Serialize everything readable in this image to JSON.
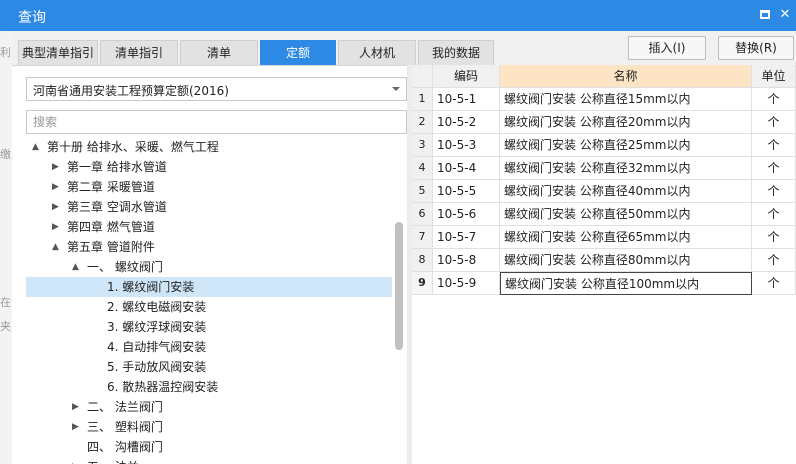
{
  "window": {
    "title": "查询",
    "maximize_icon": "maximize-icon",
    "close_icon": "close-icon",
    "close_glyph": "✕"
  },
  "left_edge_text": [
    "利",
    "缴",
    "在",
    "夹"
  ],
  "tabs": [
    {
      "label": "典型清单指引",
      "active": false
    },
    {
      "label": "清单指引",
      "active": false
    },
    {
      "label": "清单",
      "active": false
    },
    {
      "label": "定额",
      "active": true
    },
    {
      "label": "人材机",
      "active": false
    },
    {
      "label": "我的数据",
      "active": false
    }
  ],
  "toolbar": {
    "insert_label": "插入(I)",
    "replace_label": "替换(R)"
  },
  "left": {
    "library": "河南省通用安装工程预算定额(2016)",
    "search_placeholder": "搜索"
  },
  "tree": [
    {
      "label": "第十册 给排水、采暖、燃气工程",
      "level": 0,
      "expander": "▲",
      "selected": false
    },
    {
      "label": "第一章 给排水管道",
      "level": 1,
      "expander": "▶",
      "selected": false
    },
    {
      "label": "第二章 采暖管道",
      "level": 1,
      "expander": "▶",
      "selected": false
    },
    {
      "label": "第三章 空调水管道",
      "level": 1,
      "expander": "▶",
      "selected": false
    },
    {
      "label": "第四章 燃气管道",
      "level": 1,
      "expander": "▶",
      "selected": false
    },
    {
      "label": "第五章 管道附件",
      "level": 1,
      "expander": "▲",
      "selected": false
    },
    {
      "label": "一、 螺纹阀门",
      "level": 2,
      "expander": "▲",
      "selected": false
    },
    {
      "label": "1. 螺纹阀门安装",
      "level": 3,
      "expander": "",
      "selected": true
    },
    {
      "label": "2. 螺纹电磁阀安装",
      "level": 3,
      "expander": "",
      "selected": false
    },
    {
      "label": "3. 螺纹浮球阀安装",
      "level": 3,
      "expander": "",
      "selected": false
    },
    {
      "label": "4. 自动排气阀安装",
      "level": 3,
      "expander": "",
      "selected": false
    },
    {
      "label": "5. 手动放风阀安装",
      "level": 3,
      "expander": "",
      "selected": false
    },
    {
      "label": "6. 散热器温控阀安装",
      "level": 3,
      "expander": "",
      "selected": false
    },
    {
      "label": "二、 法兰阀门",
      "level": 2,
      "expander": "▶",
      "selected": false
    },
    {
      "label": "三、 塑料阀门",
      "level": 2,
      "expander": "▶",
      "selected": false
    },
    {
      "label": "四、 沟槽阀门",
      "level": 2,
      "expander": "",
      "selected": false
    },
    {
      "label": "五、 法兰",
      "level": 2,
      "expander": "▶",
      "selected": false
    }
  ],
  "grid": {
    "headers": [
      "编码",
      "名称",
      "单位"
    ],
    "rows": [
      {
        "n": "1",
        "code": "10-5-1",
        "name": "螺纹阀门安装 公称直径15mm以内",
        "unit": "个"
      },
      {
        "n": "2",
        "code": "10-5-2",
        "name": "螺纹阀门安装 公称直径20mm以内",
        "unit": "个"
      },
      {
        "n": "3",
        "code": "10-5-3",
        "name": "螺纹阀门安装 公称直径25mm以内",
        "unit": "个"
      },
      {
        "n": "4",
        "code": "10-5-4",
        "name": "螺纹阀门安装 公称直径32mm以内",
        "unit": "个"
      },
      {
        "n": "5",
        "code": "10-5-5",
        "name": "螺纹阀门安装 公称直径40mm以内",
        "unit": "个"
      },
      {
        "n": "6",
        "code": "10-5-6",
        "name": "螺纹阀门安装 公称直径50mm以内",
        "unit": "个"
      },
      {
        "n": "7",
        "code": "10-5-7",
        "name": "螺纹阀门安装 公称直径65mm以内",
        "unit": "个"
      },
      {
        "n": "8",
        "code": "10-5-8",
        "name": "螺纹阀门安装 公称直径80mm以内",
        "unit": "个"
      },
      {
        "n": "9",
        "code": "10-5-9",
        "name": "螺纹阀门安装 公称直径100mm以内",
        "unit": "个"
      }
    ],
    "current_row": "9"
  },
  "colors": {
    "titlebar": "#2d8ae4",
    "active_tab": "#2d8ae4",
    "selected_node": "#cfe6f8",
    "sorted_header": "#fce4c4"
  }
}
